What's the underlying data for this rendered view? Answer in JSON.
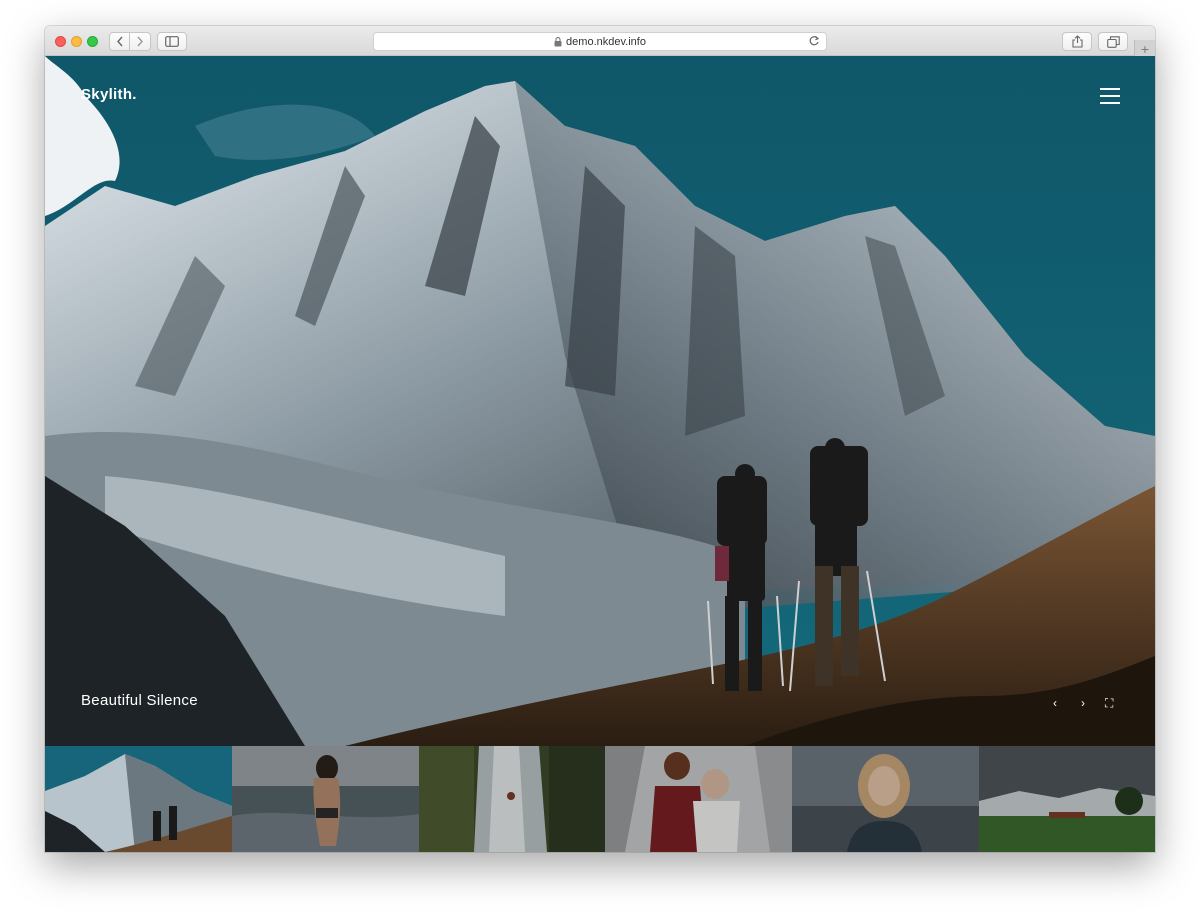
{
  "browser": {
    "url": "demo.nkdev.info",
    "icons": [
      "back-icon",
      "forward-icon",
      "sidebar-icon",
      "lock-icon",
      "reload-icon",
      "share-icon",
      "tabs-icon",
      "plus-icon"
    ],
    "new_tab_symbol": "+"
  },
  "site": {
    "brand": "Skylith.",
    "menu_icon": "hamburger-menu-icon"
  },
  "hero": {
    "caption": "Beautiful Silence",
    "controls": {
      "prev": "‹",
      "next": "›",
      "fullscreen": "⛶"
    }
  },
  "thumbnails": [
    {
      "subject": "mountain-hikers",
      "active": true
    },
    {
      "subject": "woman-on-beach",
      "active": false
    },
    {
      "subject": "waterfall-climber",
      "active": false
    },
    {
      "subject": "couple-in-snow",
      "active": false
    },
    {
      "subject": "woman-portrait",
      "active": false
    },
    {
      "subject": "green-field-landscape",
      "active": false
    }
  ],
  "colors": {
    "sky": "#0e5a6b",
    "snow": "#dfe7ec",
    "rock": "#3b434a",
    "ground": "#5a3f27",
    "traffic_red": "#fc605c",
    "traffic_yellow": "#fdbc40",
    "traffic_green": "#34c84a"
  }
}
